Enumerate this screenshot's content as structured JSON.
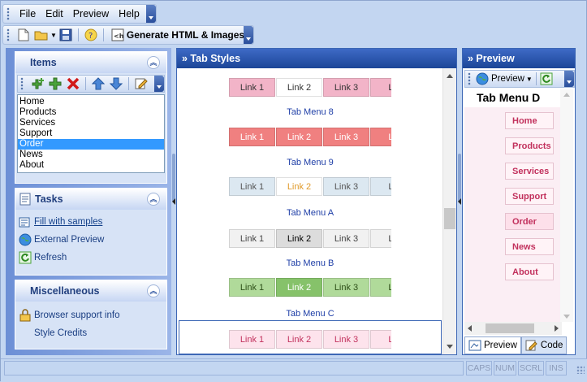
{
  "menubar": {
    "items": [
      {
        "label": "File"
      },
      {
        "label": "Edit"
      },
      {
        "label": "Preview"
      },
      {
        "label": "Help"
      }
    ]
  },
  "toolbar": {
    "generate_label": "Generate HTML & Images"
  },
  "items_panel": {
    "title": "Items",
    "list": [
      "Home",
      "Products",
      "Services",
      "Support",
      "Order",
      "News",
      "About"
    ],
    "selected": "Order"
  },
  "tasks_panel": {
    "title": "Tasks",
    "items": [
      {
        "label": "Fill with samples",
        "icon": "fill-samples-icon"
      },
      {
        "label": "External Preview",
        "icon": "globe-icon"
      },
      {
        "label": "Refresh",
        "icon": "refresh-icon"
      }
    ]
  },
  "misc_panel": {
    "title": "Miscellaneous",
    "items": [
      {
        "label": "Browser support info",
        "icon": "lock-icon"
      },
      {
        "label": "Style Credits"
      }
    ]
  },
  "tab_styles": {
    "title": "» Tab Styles",
    "rows": [
      {
        "tabs": [
          "Link 1",
          "Link 2",
          "Link 3",
          "Lo"
        ],
        "active": 1,
        "bg": "#f2b4c8",
        "active_bg": "#ffffff",
        "text": "#333333",
        "active_text": "#333333"
      },
      {
        "label": "Tab Menu 8"
      },
      {
        "tabs": [
          "Link 1",
          "Link 2",
          "Link 3",
          "Lo"
        ],
        "active": -1,
        "bg": "#f08080",
        "active_bg": "#f08080",
        "text": "#ffffff",
        "active_text": "#ffffff"
      },
      {
        "label": "Tab Menu 9"
      },
      {
        "tabs": [
          "Link 1",
          "Link 2",
          "Link 3",
          "Lo"
        ],
        "active": 1,
        "bg": "#dce8f1",
        "active_bg": "#ffffff",
        "text": "#555555",
        "active_text": "#e09a2a"
      },
      {
        "label": "Tab Menu A"
      },
      {
        "tabs": [
          "Link 1",
          "Link 2",
          "Link 3",
          "Lo"
        ],
        "active": 1,
        "bg": "#f1f1f1",
        "active_bg": "#dcdcdc",
        "text": "#444444",
        "active_text": "#000000"
      },
      {
        "label": "Tab Menu B"
      },
      {
        "tabs": [
          "Link 1",
          "Link 2",
          "Link 3",
          "Lo"
        ],
        "active": 1,
        "bg": "#b0da9a",
        "active_bg": "#86c26a",
        "text": "#2d4f18",
        "active_text": "#ffffff"
      },
      {
        "label": "Tab Menu C"
      },
      {
        "tabs": [
          "Link 1",
          "Link 2",
          "Link 3",
          "Lo"
        ],
        "active": -1,
        "bg": "#fde3ec",
        "active_bg": "#fde3ec",
        "text": "#c2315d",
        "active_text": "#c2315d"
      }
    ]
  },
  "preview": {
    "title": "» Preview",
    "button_label": "Preview",
    "menu_title": "Tab Menu D",
    "links": [
      "Home",
      "Products",
      "Services",
      "Support",
      "Order",
      "News",
      "About"
    ],
    "tab_preview": "Preview",
    "tab_code": "Code"
  },
  "statusbar": {
    "cells": [
      "CAPS",
      "NUM",
      "SCRL",
      "INS"
    ]
  }
}
